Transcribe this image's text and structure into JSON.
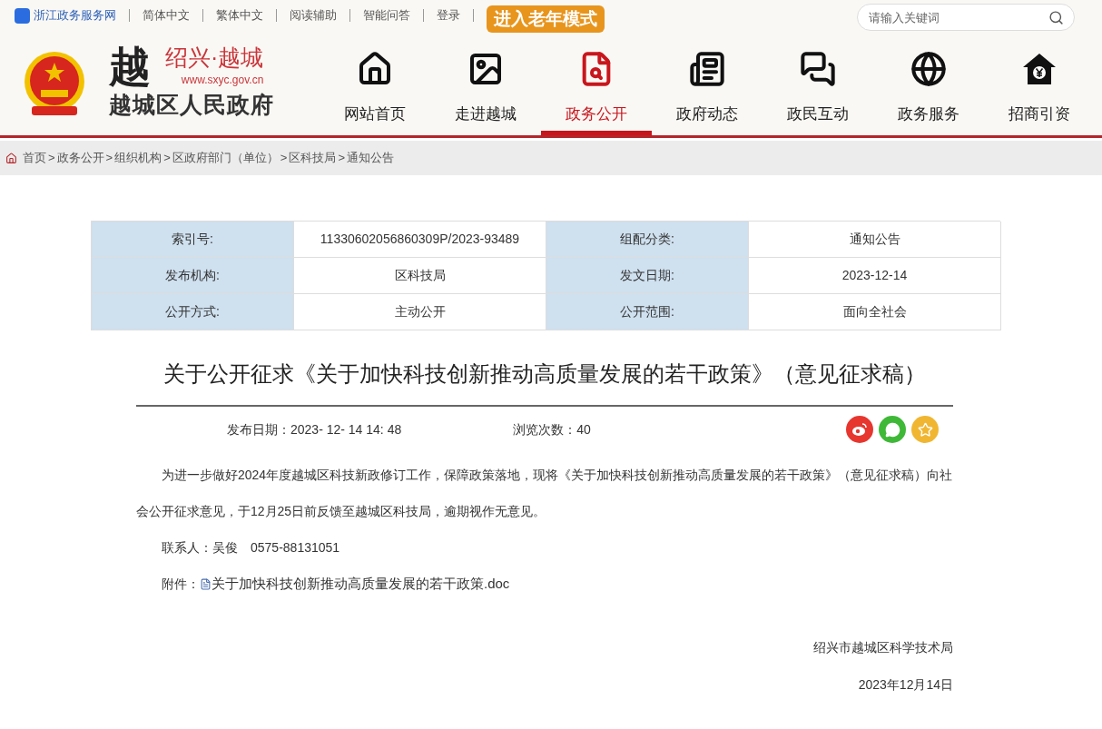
{
  "top_bar": {
    "service_link": "浙江政务服务网",
    "links": [
      "简体中文",
      "繁体中文",
      "阅读辅助",
      "智能问答",
      "登录"
    ],
    "elder_mode_button": "进入老年模式",
    "search": {
      "placeholder": "请输入关键词"
    }
  },
  "logo": {
    "mark": "越",
    "city": "绍兴·越城",
    "url": "www.sxyc.gov.cn",
    "name": "越城区人民政府"
  },
  "nav": [
    {
      "label": "网站首页",
      "selected": false
    },
    {
      "label": "走进越城",
      "selected": false
    },
    {
      "label": "政务公开",
      "selected": true
    },
    {
      "label": "政府动态",
      "selected": false
    },
    {
      "label": "政民互动",
      "selected": false
    },
    {
      "label": "政务服务",
      "selected": false
    },
    {
      "label": "招商引资",
      "selected": false
    }
  ],
  "breadcrumb": {
    "separator": ">",
    "items": [
      "首页",
      "政务公开",
      "组织机构",
      "区政府部门（单位）",
      "区科技局",
      "通知公告"
    ]
  },
  "info_table": {
    "rows": [
      [
        "索引号:",
        "11330602056860309P/2023-93489",
        "组配分类:",
        "通知公告"
      ],
      [
        "发布机构:",
        "区科技局",
        "发文日期:",
        "2023-12-14"
      ],
      [
        "公开方式:",
        "主动公开",
        "公开范围:",
        "面向全社会"
      ]
    ]
  },
  "article": {
    "title": "关于公开征求《关于加快科技创新推动高质量发展的若干政策》（意见征求稿）",
    "publish_label": "发布日期：",
    "publish_date": "2023- 12- 14 14: 48",
    "views_label": "浏览次数：",
    "views": "40",
    "body": "为进一步做好2024年度越城区科技新政修订工作，保障政策落地，现将《关于加快科技创新推动高质量发展的若干政策》（意见征求稿）向社会公开征求意见，于12月25日前反馈至越城区科技局，逾期视作无意见。",
    "contact": "联系人：吴俊　0575-88131051",
    "attachment_label": "附件：",
    "attachment_file": "关于加快科技创新推动高质量发展的若干政策.doc",
    "signature_org": "绍兴市越城区科学技术局",
    "signature_date": "2023年12月14日"
  }
}
